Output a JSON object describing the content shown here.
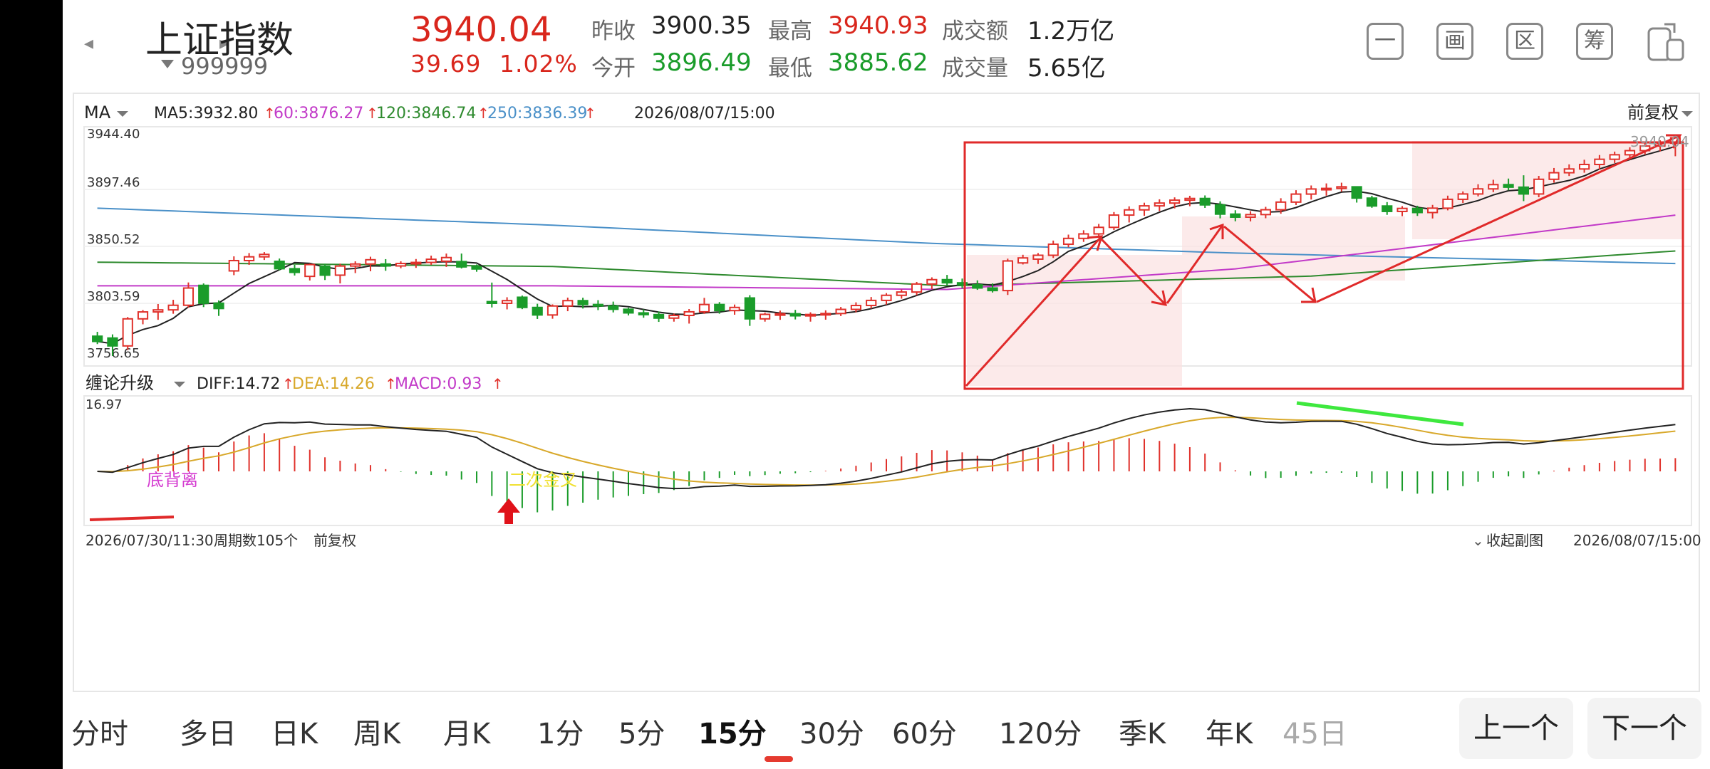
{
  "header": {
    "index_name": "上证指数",
    "index_code": "999999",
    "price": "3940.04",
    "change": "39.69",
    "change_pct": "1.02%",
    "stats": {
      "prev_close_label": "昨收",
      "prev_close": "3900.35",
      "open_label": "今开",
      "open": "3896.49",
      "high_label": "最高",
      "high": "3940.93",
      "low_label": "最低",
      "low": "3885.62",
      "amount_label": "成交额",
      "amount": "1.2万亿",
      "volume_label": "成交量",
      "volume": "5.65亿"
    },
    "tool_icons": [
      "minimize-icon",
      "screen-icon",
      "range-icon",
      "chip-icon",
      "device-icon"
    ],
    "tool_glyphs": [
      "一",
      "画",
      "区",
      "筹",
      ""
    ]
  },
  "main_chart": {
    "ma_label": "MA",
    "ma5": "MA5:3932.80",
    "ma60": "60:3876.27",
    "ma120": "120:3846.74",
    "ma250": "250:3836.39",
    "datetime": "2026/08/07/15:00",
    "adjust": "前复权",
    "price_labels": [
      "3944.40",
      "3897.46",
      "3850.52",
      "3803.59",
      "3756.65"
    ],
    "last_label": "3940.04",
    "colors": {
      "up": "#e0312b",
      "down": "#1a9c2a",
      "ma5": "#222222",
      "ma60": "#c23ac8",
      "ma120": "#2e8a2e",
      "ma250": "#4a90c8"
    }
  },
  "macd_panel": {
    "indicator_label": "缠论升级",
    "diff": "DIFF:14.72",
    "dea": "DEA:14.26",
    "macd": "MACD:0.93",
    "top_value": "16.97",
    "annotation_divergence": "底背离",
    "annotation_cross": "二次金叉",
    "colors": {
      "diff": "#222222",
      "dea": "#d8a82a",
      "macd_text": "#c23ac8"
    }
  },
  "footer": {
    "start_time": "2026/07/30/11:30",
    "period_count": "周期数105个",
    "adjust": "前复权",
    "collapse": "收起副图",
    "end_time": "2026/08/07/15:00"
  },
  "tabs": [
    "分时",
    "多日",
    "日K",
    "周K",
    "月K",
    "1分",
    "5分",
    "15分",
    "30分",
    "60分",
    "120分",
    "季K",
    "年K",
    "45日"
  ],
  "active_tab": "15分",
  "nav_buttons": {
    "prev": "上一个",
    "next": "下一个"
  },
  "chart_data": {
    "type": "candlestick",
    "interval": "15分",
    "start": "2026/07/30/11:30",
    "end": "2026/08/07/15:00",
    "periods": 105,
    "y_ticks": [
      3944.4,
      3897.46,
      3850.52,
      3803.59,
      3756.65
    ],
    "ylim": [
      3756.65,
      3944.4
    ],
    "candles_ohlc": [
      [
        3776.5,
        3780.1,
        3770.0,
        3772.2
      ],
      [
        3775.0,
        3778.0,
        3760.2,
        3768.5
      ],
      [
        3768.5,
        3792.3,
        3765.1,
        3790.8
      ],
      [
        3790.8,
        3798.0,
        3786.3,
        3796.5
      ],
      [
        3796.5,
        3803.0,
        3790.0,
        3798.2
      ],
      [
        3798.2,
        3806.5,
        3795.0,
        3802.0
      ],
      [
        3802.0,
        3820.8,
        3800.0,
        3816.2
      ],
      [
        3818.4,
        3820.0,
        3800.5,
        3803.7
      ],
      [
        3803.7,
        3806.0,
        3793.2,
        3799.3
      ],
      [
        3830.3,
        3842.3,
        3826.8,
        3838.8
      ],
      [
        3838.8,
        3845.0,
        3835.3,
        3841.9
      ],
      [
        3841.9,
        3845.8,
        3839.3,
        3843.9
      ],
      [
        3838.2,
        3840.5,
        3830.8,
        3832.1
      ],
      [
        3832.1,
        3835.3,
        3826.5,
        3829.1
      ],
      [
        3825.8,
        3836.4,
        3822.4,
        3835.5
      ],
      [
        3834.2,
        3836.2,
        3822.8,
        3826.8
      ],
      [
        3826.8,
        3836.3,
        3820.0,
        3834.3
      ],
      [
        3834.3,
        3838.2,
        3828.5,
        3836.0
      ],
      [
        3836.0,
        3842.0,
        3830.0,
        3839.5
      ],
      [
        3836.0,
        3840.0,
        3830.4,
        3834.4
      ],
      [
        3834.4,
        3838.2,
        3832.5,
        3836.4
      ],
      [
        3836.4,
        3840.1,
        3832.8,
        3837.3
      ],
      [
        3837.3,
        3842.9,
        3835.3,
        3839.9
      ],
      [
        3838.3,
        3844.6,
        3833.6,
        3841.3
      ],
      [
        3838.0,
        3844.6,
        3832.3,
        3833.6
      ],
      [
        3833.6,
        3835.6,
        3829.6,
        3831.9
      ],
      [
        3805.0,
        3820.7,
        3800.2,
        3803.6
      ],
      [
        3803.6,
        3808.6,
        3798.6,
        3805.8
      ],
      [
        3808.6,
        3810.0,
        3798.8,
        3800.2
      ],
      [
        3800.2,
        3803.2,
        3790.7,
        3794.0
      ],
      [
        3794.0,
        3802.7,
        3790.9,
        3801.4
      ],
      [
        3801.4,
        3808.3,
        3797.1,
        3805.8
      ],
      [
        3805.8,
        3808.2,
        3799.3,
        3802.6
      ],
      [
        3802.6,
        3806.2,
        3798.0,
        3801.4
      ],
      [
        3801.4,
        3805.0,
        3796.1,
        3798.7
      ],
      [
        3798.7,
        3800.0,
        3793.6,
        3795.7
      ],
      [
        3795.7,
        3798.6,
        3791.7,
        3794.3
      ],
      [
        3794.3,
        3796.9,
        3788.3,
        3791.4
      ],
      [
        3791.4,
        3795.1,
        3788.5,
        3793.6
      ],
      [
        3793.6,
        3798.9,
        3786.9,
        3796.6
      ],
      [
        3796.6,
        3808.1,
        3794.9,
        3802.6
      ],
      [
        3802.6,
        3804.6,
        3795.0,
        3797.6
      ],
      [
        3797.6,
        3802.6,
        3794.2,
        3800.2
      ],
      [
        3808.0,
        3810.3,
        3785.0,
        3790.8
      ],
      [
        3790.8,
        3796.0,
        3788.5,
        3794.5
      ],
      [
        3794.5,
        3797.6,
        3790.0,
        3795.0
      ],
      [
        3795.0,
        3798.2,
        3790.3,
        3793.3
      ],
      [
        3793.3,
        3796.2,
        3788.5,
        3794.4
      ],
      [
        3794.4,
        3797.8,
        3790.1,
        3795.2
      ],
      [
        3795.2,
        3800.6,
        3793.1,
        3798.6
      ],
      [
        3798.6,
        3804.4,
        3796.2,
        3801.8
      ],
      [
        3801.8,
        3808.8,
        3799.3,
        3806.0
      ],
      [
        3806.0,
        3812.0,
        3802.5,
        3810.2
      ],
      [
        3810.2,
        3815.0,
        3807.4,
        3812.9
      ],
      [
        3812.9,
        3821.2,
        3810.3,
        3819.5
      ],
      [
        3819.5,
        3825.0,
        3815.4,
        3823.1
      ],
      [
        3823.1,
        3827.0,
        3818.5,
        3820.5
      ],
      [
        3820.5,
        3824.0,
        3816.0,
        3818.8
      ],
      [
        3818.8,
        3822.5,
        3814.7,
        3816.2
      ],
      [
        3816.2,
        3820.0,
        3812.5,
        3814.1
      ],
      [
        3814.1,
        3840.4,
        3810.5,
        3838.5
      ],
      [
        3836.9,
        3843.6,
        3835.6,
        3841.0
      ],
      [
        3840.0,
        3845.0,
        3836.0,
        3843.2
      ],
      [
        3843.2,
        3855.3,
        3841.0,
        3852.3
      ],
      [
        3852.3,
        3860.2,
        3849.7,
        3857.1
      ],
      [
        3857.1,
        3863.8,
        3854.2,
        3860.8
      ],
      [
        3860.8,
        3869.0,
        3858.0,
        3866.2
      ],
      [
        3866.2,
        3878.8,
        3864.0,
        3876.3
      ],
      [
        3876.3,
        3883.5,
        3870.2,
        3880.6
      ],
      [
        3880.6,
        3886.5,
        3875.7,
        3883.9
      ],
      [
        3883.9,
        3889.3,
        3879.6,
        3886.2
      ],
      [
        3886.2,
        3890.9,
        3881.8,
        3888.6
      ],
      [
        3888.6,
        3892.2,
        3883.6,
        3890.0
      ],
      [
        3890.0,
        3892.5,
        3882.2,
        3884.7
      ],
      [
        3884.7,
        3887.6,
        3873.6,
        3877.1
      ],
      [
        3877.1,
        3880.3,
        3871.2,
        3874.6
      ],
      [
        3874.6,
        3879.5,
        3871.1,
        3876.7
      ],
      [
        3876.7,
        3883.1,
        3873.7,
        3880.7
      ],
      [
        3880.7,
        3890.2,
        3877.4,
        3887.0
      ],
      [
        3887.0,
        3896.8,
        3884.6,
        3893.6
      ],
      [
        3893.6,
        3900.7,
        3889.1,
        3897.8
      ],
      [
        3897.8,
        3902.4,
        3892.3,
        3898.3
      ],
      [
        3898.3,
        3903.0,
        3895.6,
        3899.6
      ],
      [
        3899.6,
        3899.9,
        3886.6,
        3890.3
      ],
      [
        3890.3,
        3892.2,
        3882.3,
        3883.8
      ],
      [
        3883.8,
        3887.0,
        3876.5,
        3879.3
      ],
      [
        3879.3,
        3883.7,
        3875.4,
        3881.8
      ],
      [
        3881.8,
        3884.0,
        3875.6,
        3878.4
      ],
      [
        3878.4,
        3884.7,
        3873.5,
        3882.0
      ],
      [
        3882.0,
        3892.3,
        3880.2,
        3889.3
      ],
      [
        3889.3,
        3895.8,
        3886.3,
        3893.7
      ],
      [
        3893.7,
        3901.7,
        3891.7,
        3897.9
      ],
      [
        3897.9,
        3905.4,
        3895.2,
        3901.4
      ],
      [
        3901.4,
        3906.4,
        3896.7,
        3899.3
      ],
      [
        3899.3,
        3909.1,
        3887.8,
        3893.7
      ],
      [
        3893.7,
        3908.6,
        3891.0,
        3905.8
      ],
      [
        3905.8,
        3915.1,
        3903.0,
        3911.2
      ],
      [
        3911.2,
        3918.1,
        3908.5,
        3914.3
      ],
      [
        3914.3,
        3921.9,
        3911.2,
        3918.0
      ],
      [
        3918.0,
        3925.8,
        3913.7,
        3922.3
      ],
      [
        3922.3,
        3928.6,
        3919.2,
        3926.0
      ],
      [
        3926.0,
        3932.2,
        3921.9,
        3929.4
      ],
      [
        3929.4,
        3936.0,
        3926.1,
        3933.2
      ],
      [
        3933.2,
        3937.9,
        3928.8,
        3935.5
      ],
      [
        3935.5,
        3940.9,
        3924.8,
        3940.0
      ]
    ],
    "series": [
      {
        "name": "MA5",
        "last": 3932.8
      },
      {
        "name": "60",
        "last": 3876.27
      },
      {
        "name": "120",
        "last": 3846.74
      },
      {
        "name": "250",
        "last": 3836.39
      }
    ],
    "macd": {
      "diff": 14.72,
      "dea": 14.26,
      "macd": 0.93,
      "top": 16.97
    }
  }
}
